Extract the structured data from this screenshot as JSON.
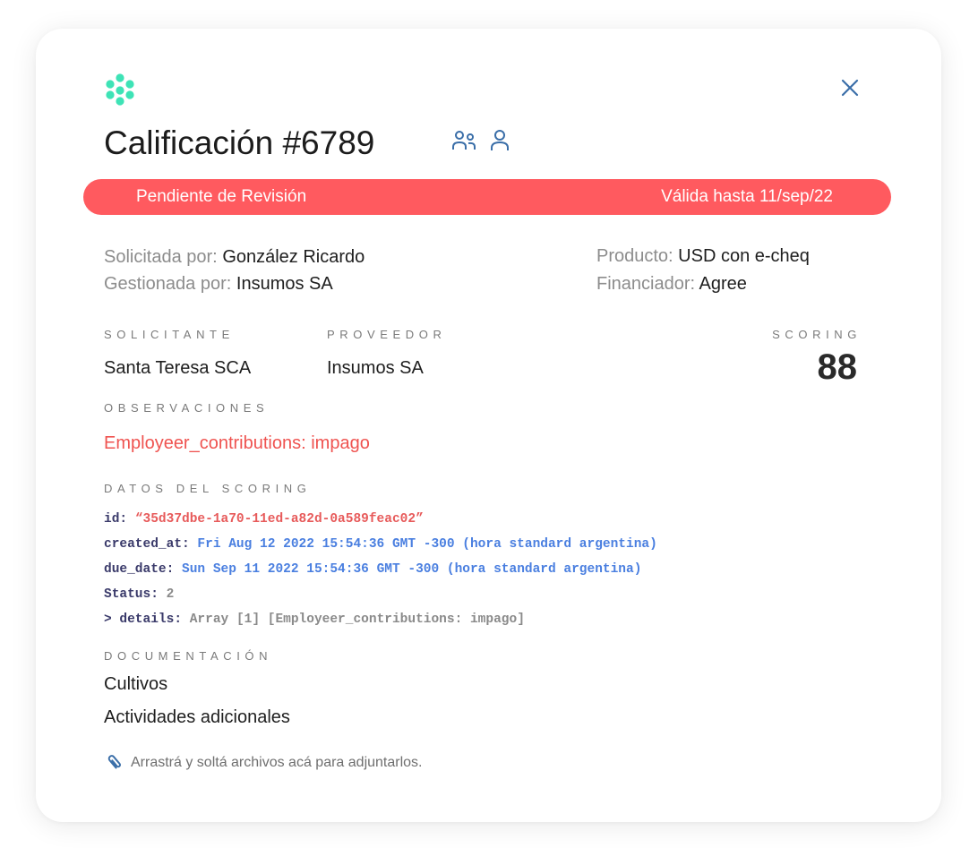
{
  "header": {
    "title": "Calificación #6789",
    "logo_icon": "dots-cluster-logo",
    "brand_color": "#3ee3b6"
  },
  "status": {
    "label": "Pendiente de Revisión",
    "valid_until": "Válida hasta 11/sep/22",
    "color": "#ff5a5f"
  },
  "meta": {
    "requested_label": "Solicitada por:",
    "requested_value": "González Ricardo",
    "managed_label": "Gestionada por:",
    "managed_value": "Insumos SA",
    "product_label": "Producto:",
    "product_value": "USD con e-cheq",
    "financer_label": "Financiador:",
    "financer_value": "Agree"
  },
  "sections": {
    "solicitante_label": "SOLICITANTE",
    "solicitante_value": "Santa Teresa SCA",
    "proveedor_label": "PROVEEDOR",
    "proveedor_value": "Insumos SA",
    "scoring_label": "SCORING",
    "scoring_value": "88",
    "observaciones_label": "OBSERVACIONES",
    "observaciones_value": "Employeer_contributions: impago",
    "datos_label": "DATOS DEL SCORING",
    "documentacion_label": "DOCUMENTACIÓN"
  },
  "scoring_data": {
    "id_key": "id",
    "id_value": "“35d37dbe-1a70-11ed-a82d-0a589feac02”",
    "created_key": "created_at",
    "created_value": "Fri Aug 12 2022 15:54:36 GMT -300 (hora standard argentina)",
    "due_key": "due_date",
    "due_value": "Sun Sep 11 2022 15:54:36 GMT -300 (hora standard argentina)",
    "status_key": "Status",
    "status_value": "2",
    "details_key": "> details",
    "details_value": "Array [1] [Employeer_contributions: impago]"
  },
  "documents": [
    "Cultivos",
    "Actividades adicionales"
  ],
  "attach_text": "Arrastrá y soltá archivos acá para adjuntarlos."
}
